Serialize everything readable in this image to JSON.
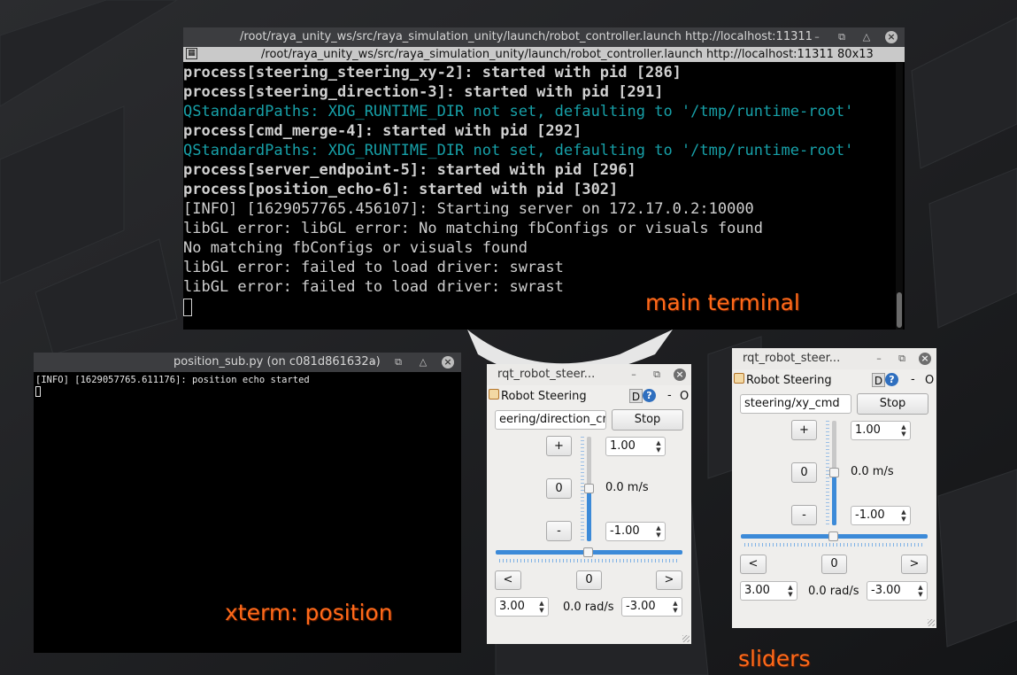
{
  "main_terminal": {
    "title": "/root/raya_unity_ws/src/raya_simulation_unity/launch/robot_controller.launch http://localhost:11311",
    "header": "/root/raya_unity_ws/src/raya_simulation_unity/launch/robot_controller.launch http://localhost:11311 80x13",
    "lines": [
      "process[steering_steering_xy-2]: started with pid [286]",
      "process[steering_direction-3]: started with pid [291]",
      "QStandardPaths: XDG_RUNTIME_DIR not set, defaulting to '/tmp/runtime-root'",
      "process[cmd_merge-4]: started with pid [292]",
      "QStandardPaths: XDG_RUNTIME_DIR not set, defaulting to '/tmp/runtime-root'",
      "process[server_endpoint-5]: started with pid [296]",
      "process[position_echo-6]: started with pid [302]",
      "[INFO] [1629057765.456107]: Starting server on 172.17.0.2:10000",
      "libGL error: libGL error: No matching fbConfigs or visuals found",
      "No matching fbConfigs or visuals found",
      "libGL error: failed to load driver: swrast",
      "libGL error: failed to load driver: swrast"
    ],
    "overlay_label": "main terminal"
  },
  "xterm": {
    "title": "position_sub.py (on c081d861632a)",
    "line": "[INFO] [1629057765.611176]: position echo started",
    "overlay_label": "xterm: position"
  },
  "rqt_left": {
    "title": "rqt_robot_steer...",
    "plugin_label": "Robot Steering",
    "d_label": "D",
    "help_label": "?",
    "dash_label": "-",
    "o_label": "O",
    "topic": "eering/direction_cmd",
    "stop_label": "Stop",
    "plus_label": "+",
    "zero_label": "0",
    "minus_label": "-",
    "max_linear": "1.00",
    "min_linear": "-1.00",
    "linear_readout": "0.0 m/s",
    "left_label": "<",
    "center_label": "0",
    "right_label": ">",
    "max_angular": "3.00",
    "min_angular": "-3.00",
    "angular_readout": "0.0 rad/s"
  },
  "rqt_right": {
    "title": "rqt_robot_steer...",
    "plugin_label": "Robot Steering",
    "d_label": "D",
    "help_label": "?",
    "dash_label": "-",
    "o_label": "O",
    "topic": "steering/xy_cmd",
    "stop_label": "Stop",
    "plus_label": "+",
    "zero_label": "0",
    "minus_label": "-",
    "max_linear": "1.00",
    "min_linear": "-1.00",
    "linear_readout": "0.0 m/s",
    "left_label": "<",
    "center_label": "0",
    "right_label": ">",
    "max_angular": "3.00",
    "min_angular": "-3.00",
    "angular_readout": "0.0 rad/s"
  },
  "sliders_overlay_label": "sliders",
  "colors": {
    "overlay": "#ff6a1a",
    "terminal_cyan": "#17a0a8",
    "slider_blue": "#3c8ad8"
  }
}
